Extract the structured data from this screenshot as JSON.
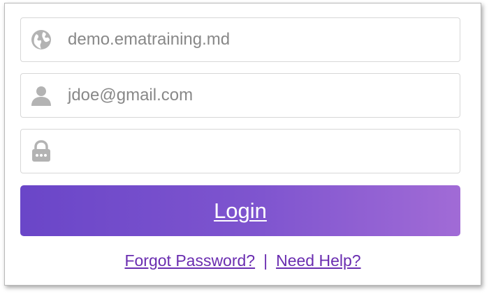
{
  "login_form": {
    "domain_field": {
      "value": "demo.ematraining.md",
      "icon": "globe-icon"
    },
    "username_field": {
      "value": "jdoe@gmail.com",
      "icon": "user-icon"
    },
    "password_field": {
      "value": "",
      "icon": "lock-icon"
    },
    "login_button": {
      "label": "Login"
    },
    "footer_links": {
      "forgot_password": "Forgot Password?",
      "separator": "|",
      "need_help": "Need Help?"
    }
  },
  "colors": {
    "button_gradient_start": "#6a46c8",
    "button_gradient_end": "#a16bd6",
    "link": "#6a2db0",
    "field_text": "#888888",
    "icon": "#b3b3b3"
  }
}
